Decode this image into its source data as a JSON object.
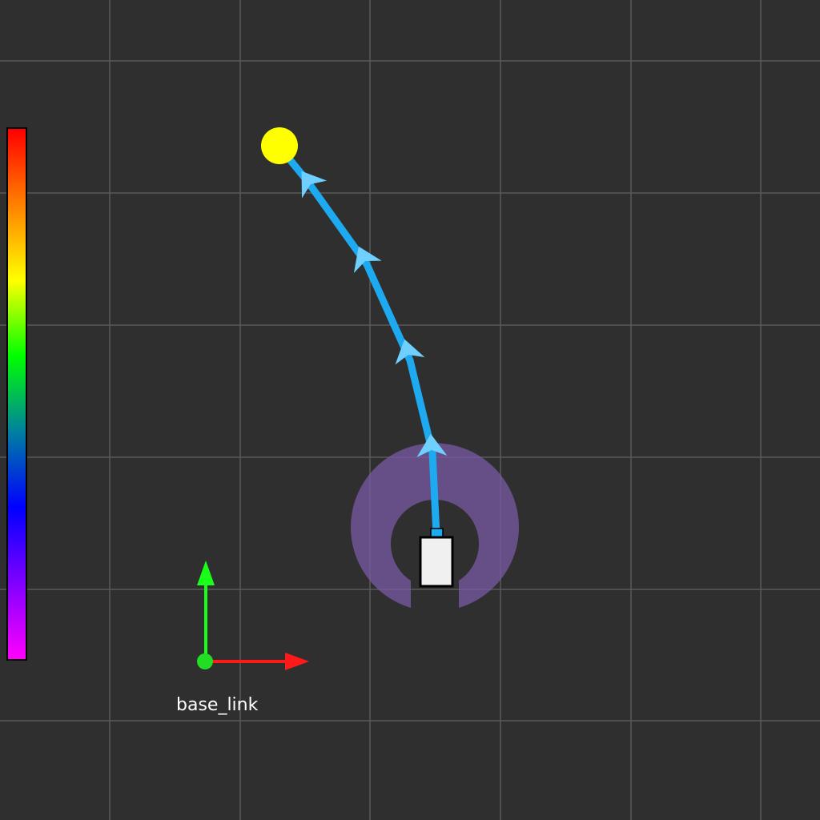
{
  "frame": {
    "label": "base_link",
    "axes": [
      {
        "name": "x-axis",
        "color": "#ff1a1a"
      },
      {
        "name": "y-axis",
        "color": "#1aff1a"
      }
    ],
    "origin_color": "#22dd22"
  },
  "colorbar": {
    "gradient_stops": [
      "#ff0000",
      "#ff8000",
      "#ffff00",
      "#00ff00",
      "#0080a0",
      "#0000ff",
      "#8000ff",
      "#ff00ff"
    ]
  },
  "grid": {
    "color": "#5a5a5a",
    "background": "#2f2f2f"
  },
  "path": {
    "color": "#1eaaf0",
    "arrow_color": "#6fd0ff",
    "waypoint_count": 4
  },
  "goal": {
    "color": "#ffff00"
  },
  "robot": {
    "body_color": "#f0f0f0",
    "outline_color": "#000000"
  },
  "costmap_ring": {
    "color": "#7a5aa6",
    "opacity": 0.75
  }
}
